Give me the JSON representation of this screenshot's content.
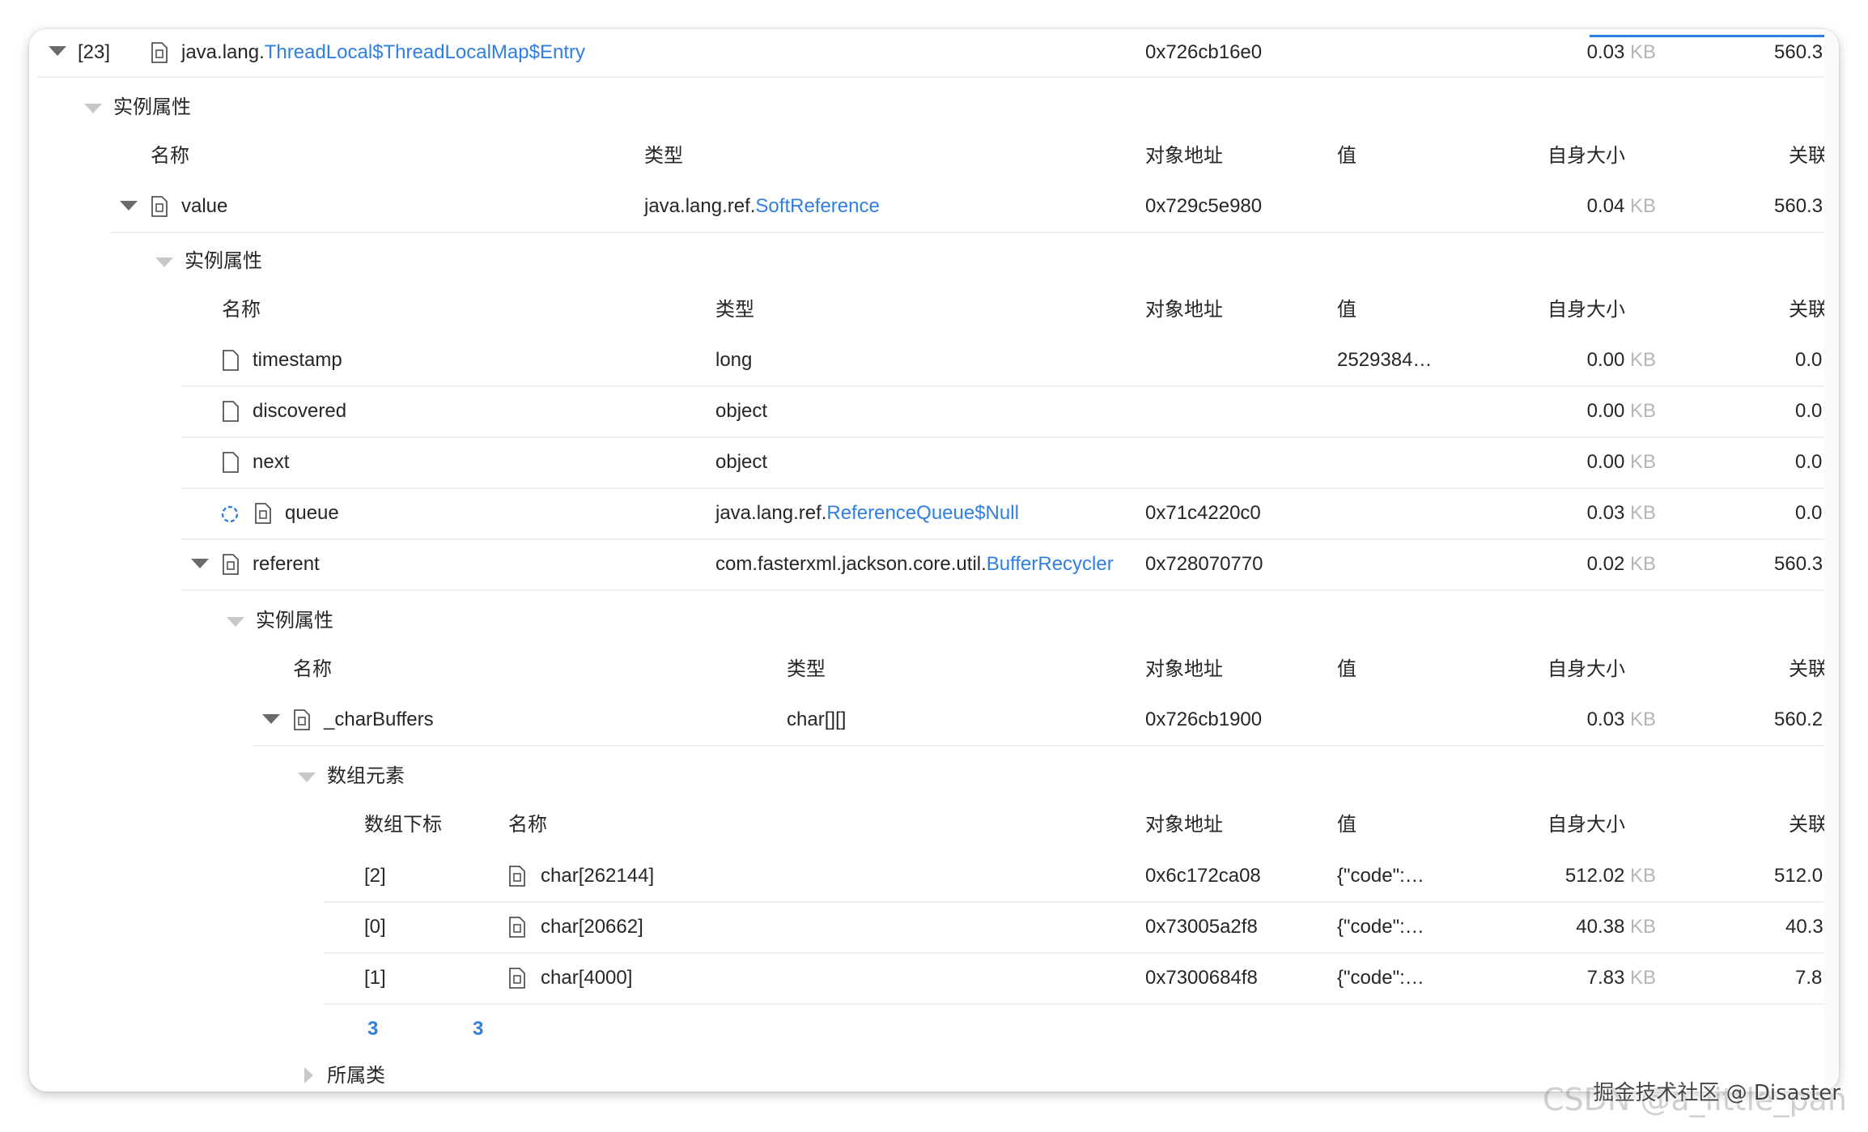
{
  "root": {
    "index": "[23]",
    "type_prefix": "java.lang.",
    "type_link": "ThreadLocal$ThreadLocalMap$Entry",
    "address": "0x726cb16e0",
    "self_size": "0.03",
    "related_size": "560.3",
    "unit": "KB"
  },
  "section1": {
    "title": "实例属性"
  },
  "headers1": {
    "name": "名称",
    "type": "类型",
    "address": "对象地址",
    "value": "值",
    "self_size": "自身大小",
    "related": "关联"
  },
  "value_row": {
    "name": "value",
    "type_prefix": "java.lang.ref.",
    "type_link": "SoftReference",
    "address": "0x729c5e980",
    "self_size": "0.04",
    "related_size": "560.3",
    "unit": "KB"
  },
  "section2": {
    "title": "实例属性"
  },
  "headers2": {
    "name": "名称",
    "type": "类型",
    "address": "对象地址",
    "value": "值",
    "self_size": "自身大小",
    "related": "关联"
  },
  "level2_rows": [
    {
      "name": "timestamp",
      "type": "long",
      "address": "",
      "value": "2529384…",
      "self_size": "0.00",
      "related": "0.0",
      "unit": "KB"
    },
    {
      "name": "discovered",
      "type": "object",
      "address": "",
      "value": "",
      "self_size": "0.00",
      "related": "0.0",
      "unit": "KB"
    },
    {
      "name": "next",
      "type": "object",
      "address": "",
      "value": "",
      "self_size": "0.00",
      "related": "0.0",
      "unit": "KB"
    }
  ],
  "queue_row": {
    "name": "queue",
    "type_prefix": "java.lang.ref.",
    "type_link": "ReferenceQueue$Null",
    "address": "0x71c4220c0",
    "self_size": "0.03",
    "related_size": "0.0",
    "unit": "KB"
  },
  "referent_row": {
    "name": "referent",
    "type_prefix": "com.fasterxml.jackson.core.util.",
    "type_link": "BufferRecycler",
    "address": "0x728070770",
    "self_size": "0.02",
    "related_size": "560.3",
    "unit": "KB"
  },
  "section3": {
    "title": "实例属性"
  },
  "headers3": {
    "name": "名称",
    "type": "类型",
    "address": "对象地址",
    "value": "值",
    "self_size": "自身大小",
    "related": "关联"
  },
  "charbuffers_row": {
    "name": "_charBuffers",
    "type": "char[][]",
    "address": "0x726cb1900",
    "self_size": "0.03",
    "related_size": "560.2",
    "unit": "KB"
  },
  "section4": {
    "title": "数组元素"
  },
  "headers4": {
    "index": "数组下标",
    "name": "名称",
    "address": "对象地址",
    "value": "值",
    "self_size": "自身大小",
    "related": "关联"
  },
  "array_rows": [
    {
      "index": "[2]",
      "name": "char[262144]",
      "address": "0x6c172ca08",
      "value": "{\"code\":…",
      "self_size": "512.02",
      "related": "512.0",
      "unit": "KB"
    },
    {
      "index": "[0]",
      "name": "char[20662]",
      "address": "0x73005a2f8",
      "value": "{\"code\":…",
      "self_size": "40.38",
      "related": "40.3",
      "unit": "KB"
    },
    {
      "index": "[1]",
      "name": "char[4000]",
      "address": "0x7300684f8",
      "value": "{\"code\":…",
      "self_size": "7.83",
      "related": "7.8",
      "unit": "KB"
    }
  ],
  "pager": {
    "total": "3",
    "shown": "3"
  },
  "section5": {
    "title": "所属类"
  },
  "watermark": {
    "back": "CSDN @a_little_pan",
    "front": "掘金技术社区 @ Disaster"
  },
  "colors": {
    "link": "#2f7fe0",
    "unit": "#b5b5b5",
    "divider": "#eeeeee",
    "text": "#262626"
  },
  "icons": {
    "expand": "caret-down-icon",
    "collapse": "caret-right-icon",
    "object": "object-file-icon",
    "field": "file-icon",
    "loading": "loading-spinner-icon"
  }
}
